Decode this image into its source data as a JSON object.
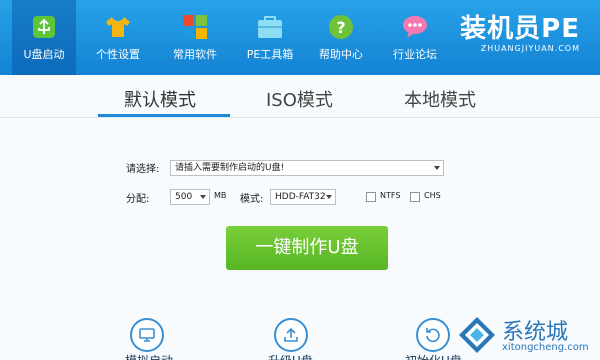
{
  "nav": [
    {
      "label": "U盘启动",
      "icon": "usb-icon",
      "active": true
    },
    {
      "label": "个性设置",
      "icon": "shirt-icon"
    },
    {
      "label": "常用软件",
      "icon": "apps-grid-icon"
    },
    {
      "label": "PE工具箱",
      "icon": "toolbox-icon"
    },
    {
      "label": "帮助中心",
      "icon": "help-icon"
    },
    {
      "label": "行业论坛",
      "icon": "chat-icon"
    }
  ],
  "logo": {
    "title": "装机员PE",
    "subtitle": "ZHUANGJIYUAN.COM"
  },
  "tabs": [
    "默认模式",
    "ISO模式",
    "本地模式"
  ],
  "form": {
    "select_label": "请选择:",
    "select_value": "请插入需要制作启动的U盘!",
    "partition_label": "分配:",
    "partition_value": "500",
    "partition_unit": "MB",
    "mode_label": "模式:",
    "mode_value": "HDD-FAT32",
    "ntfs_label": "NTFS",
    "chs_label": "CHS"
  },
  "action_button": "一键制作U盘",
  "bottom": [
    {
      "label": "模拟启动",
      "icon": "monitor-icon"
    },
    {
      "label": "升级U盘",
      "icon": "upload-icon"
    },
    {
      "label": "初始化U盘",
      "icon": "reset-icon"
    }
  ],
  "watermark": {
    "title": "系统城",
    "url": "xitongcheng.com"
  },
  "colors": {
    "header": "#1e90dc",
    "action": "#62bf2c",
    "accent": "#1e8ad8"
  }
}
